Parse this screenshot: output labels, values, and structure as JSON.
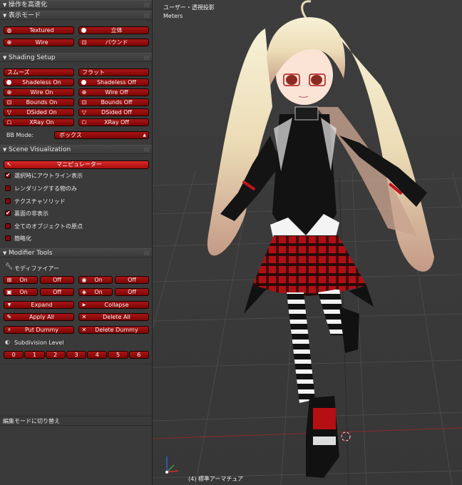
{
  "panel": {
    "fast_nav": "操作を高速化",
    "display_mode": {
      "title": "表示モード",
      "textured": "Textured",
      "solid": "立体",
      "wire": "Wire",
      "bound": "バウンド"
    },
    "shading": {
      "title": "Shading Setup",
      "smooth": "スムーズ",
      "flat": "フラット",
      "shadeless_on": "Shadeless On",
      "shadeless_off": "Shadeless Off",
      "wire_on": "Wire On",
      "wire_off": "Wire Off",
      "bounds_on": "Bounds On",
      "bounds_off": "Bounds Off",
      "dsided_on": "DSided On",
      "dsided_off": "DSided Off",
      "xray_on": "XRay On",
      "xray_off": "XRay Off",
      "bb_mode_label": "BB Mode:",
      "bb_mode_value": "ボックス"
    },
    "scene_vis": {
      "title": "Scene Visualization",
      "manipulator": "マニピュレーター",
      "options": [
        {
          "label": "選択時にアウトライン表示",
          "checked": true
        },
        {
          "label": "レンダリングする物のみ",
          "checked": false
        },
        {
          "label": "テクスチャソリッド",
          "checked": false
        },
        {
          "label": "裏面の非表示",
          "checked": true
        },
        {
          "label": "全てのオブジェクトの原点",
          "checked": false
        },
        {
          "label": "簡略化",
          "checked": false
        }
      ]
    },
    "modifier": {
      "title": "Modifier Tools",
      "modifier_label": "モディファイアー",
      "on": "On",
      "off": "Off",
      "expand": "Expand",
      "collapse": "Collapse",
      "apply_all": "Apply All",
      "delete_all": "Delete All",
      "put_dummy": "Put Dummy",
      "delete_dummy": "Delete Dummy",
      "subdiv_label": "Subdivision Level",
      "levels": [
        "0",
        "1",
        "2",
        "3",
        "4",
        "5",
        "6"
      ]
    },
    "status": "編集モードに切り替え"
  },
  "viewport": {
    "view_name": "ユーザー・透視投影",
    "units": "Meters",
    "object_name": "(4) 標準アーマチュア"
  },
  "colors": {
    "button_red": "#a81515",
    "panel_bg": "#3a3a3a",
    "viewport_bg": "#393939"
  }
}
